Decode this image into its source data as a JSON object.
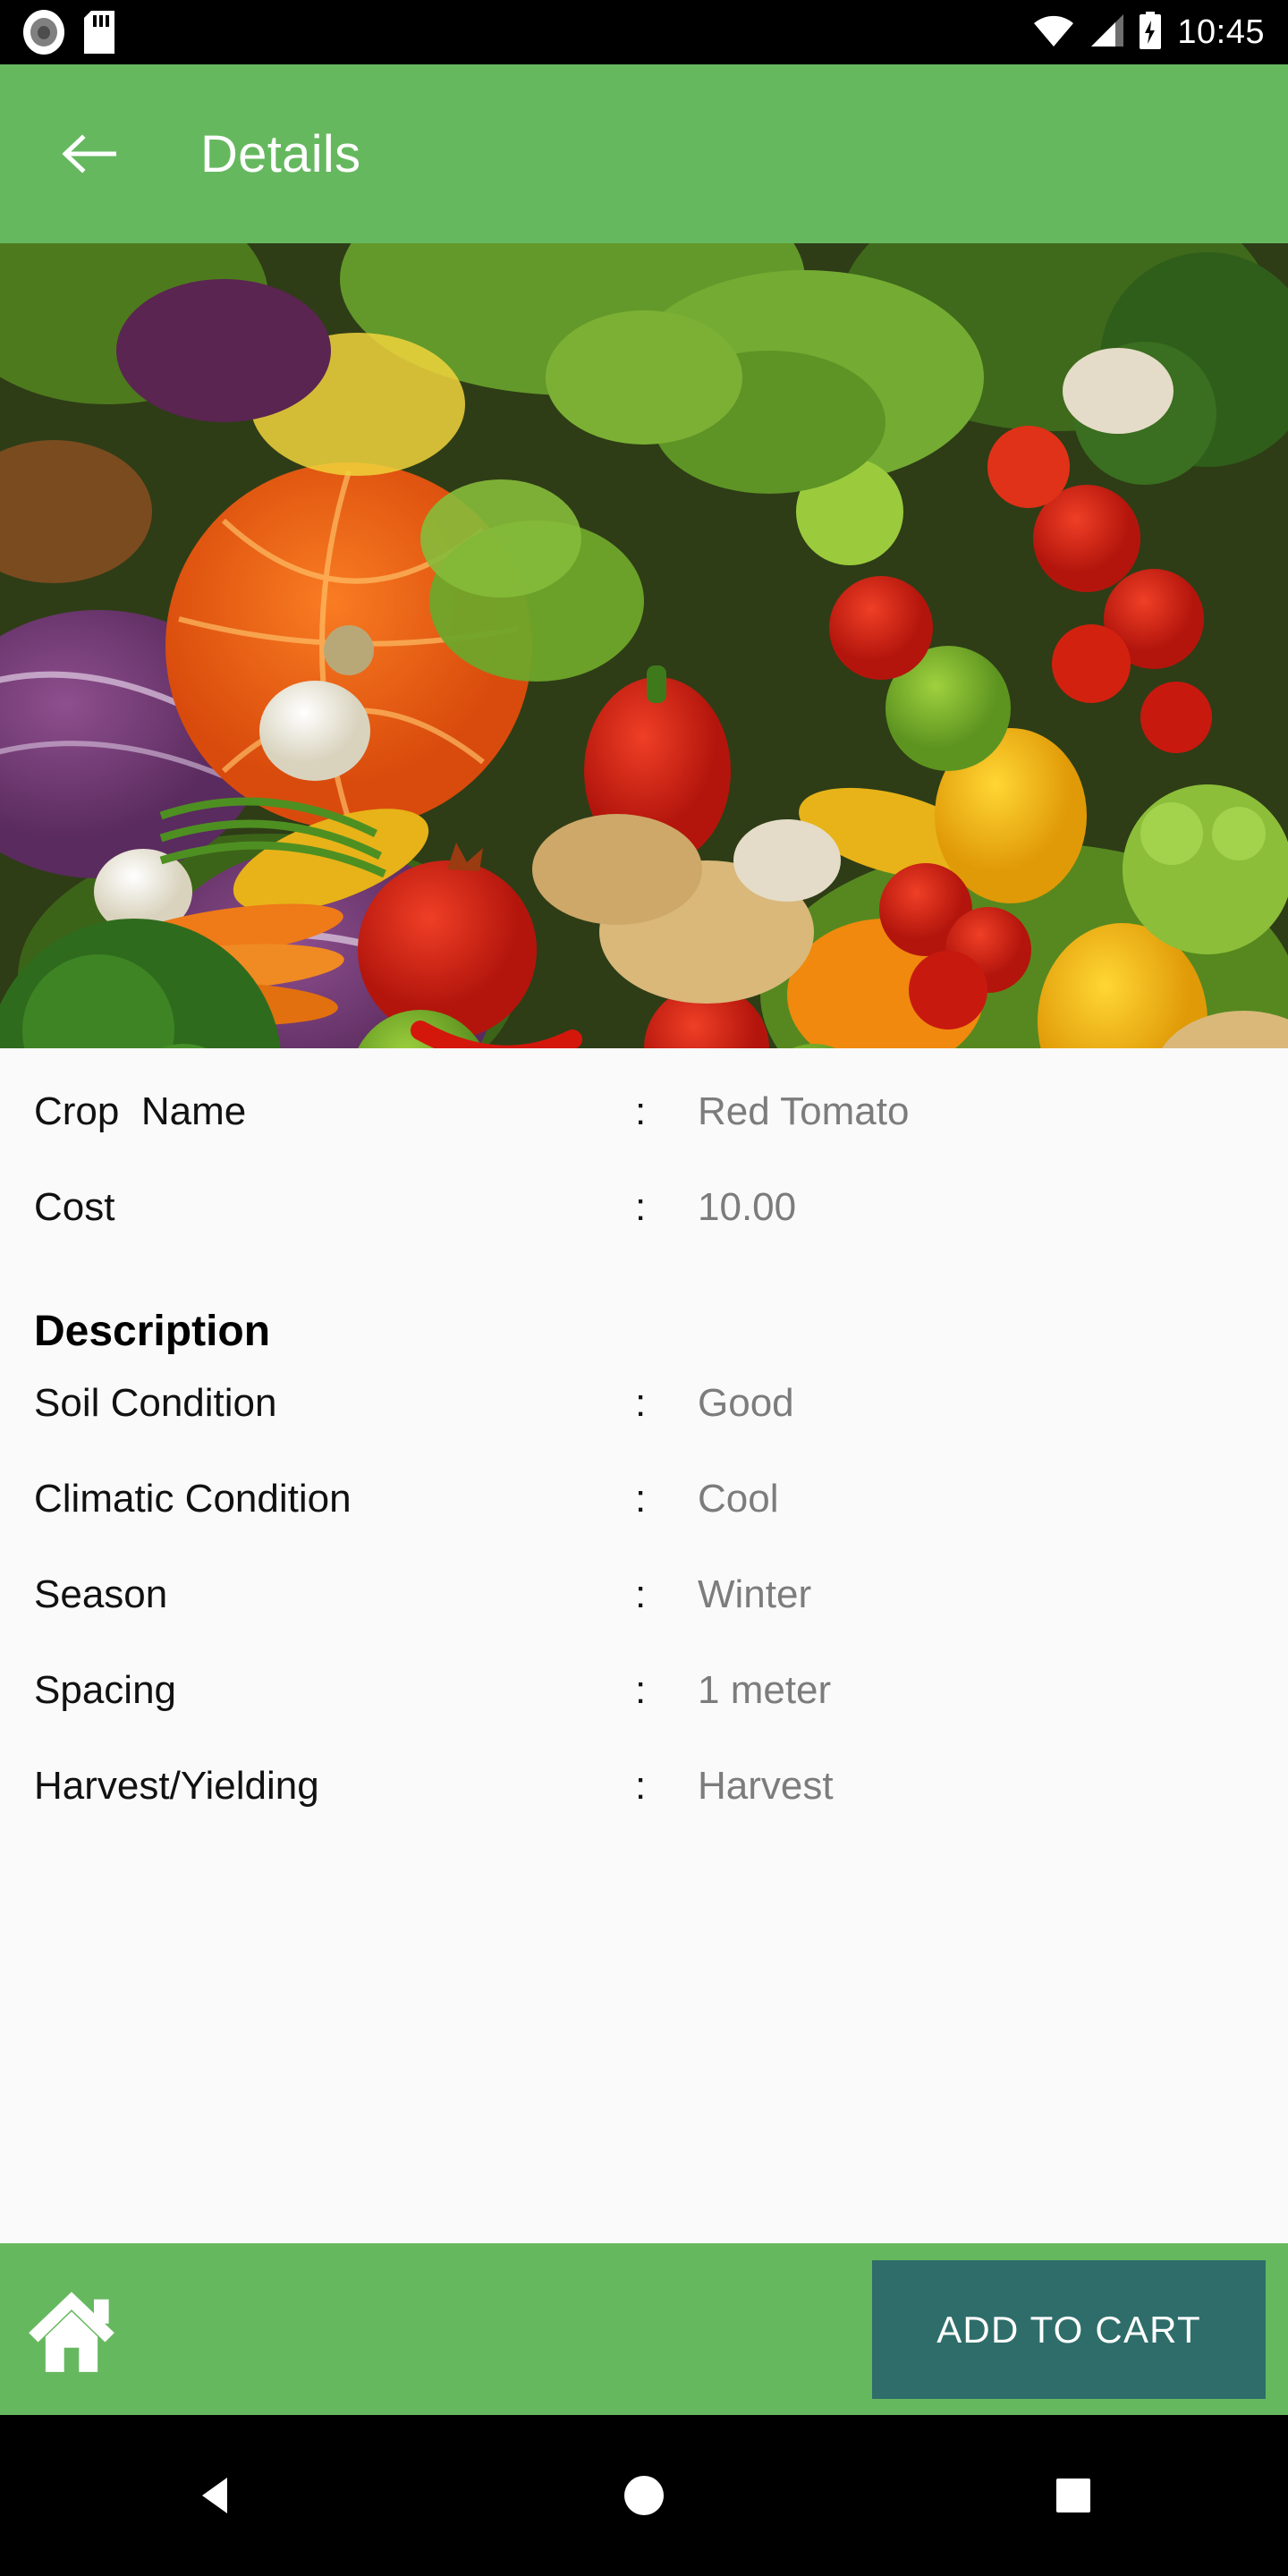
{
  "status_bar": {
    "time": "10:45",
    "icons": [
      "record-icon",
      "sd-card-icon",
      "wifi-icon",
      "cellular-signal-icon",
      "battery-charging-icon"
    ]
  },
  "app_bar": {
    "back_label": "back-arrow-icon",
    "title": "Details",
    "background_color": "#66B85F"
  },
  "hero": {
    "alt": "assorted fresh vegetables and fruits"
  },
  "details": {
    "rows_top": [
      {
        "label": "Crop  Name",
        "colon": ":",
        "value": "Red Tomato"
      },
      {
        "label": "Cost",
        "colon": ":",
        "value": "10.00"
      }
    ],
    "section_title": "Description",
    "rows_description": [
      {
        "label": "Soil Condition",
        "colon": ":",
        "value": "Good"
      },
      {
        "label": "Climatic Condition",
        "colon": ":",
        "value": "Cool"
      },
      {
        "label": "Season",
        "colon": ":",
        "value": "Winter"
      },
      {
        "label": "Spacing",
        "colon": ":",
        "value": "1 meter"
      },
      {
        "label": "Harvest/Yielding",
        "colon": ":",
        "value": "Harvest"
      }
    ]
  },
  "bottom_bar": {
    "home_icon": "home-icon",
    "add_to_cart_label": "ADD TO CART",
    "button_color": "#2E6D6A",
    "background_color": "#66B85F"
  },
  "nav_bar": {
    "back": "nav-back-triangle",
    "home": "nav-home-circle",
    "recents": "nav-recents-square"
  }
}
